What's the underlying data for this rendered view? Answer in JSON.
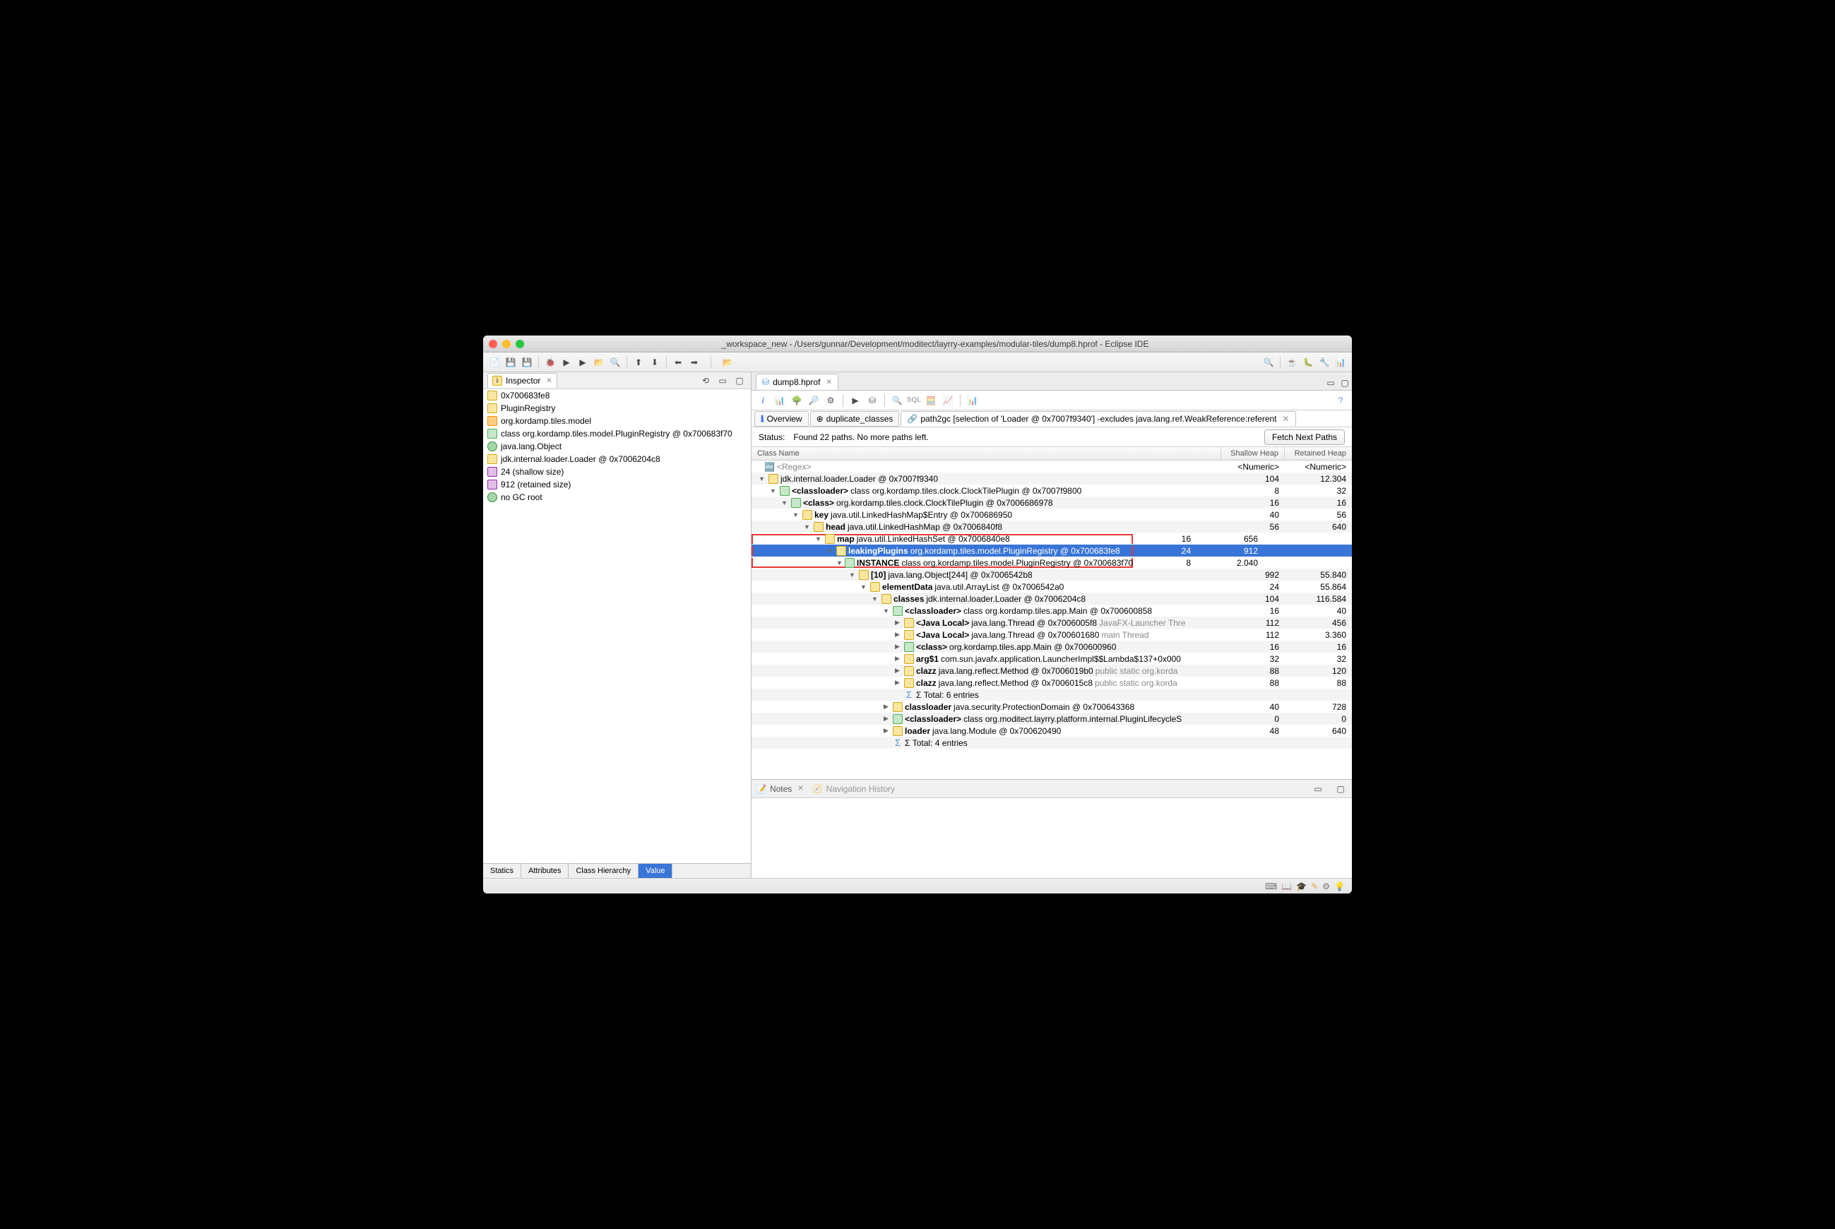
{
  "window": {
    "title": "_workspace_new - /Users/gunnar/Development/moditect/layrry-examples/modular-tiles/dump8.hprof - Eclipse IDE"
  },
  "inspector": {
    "tab_label": "Inspector",
    "rows": [
      {
        "icon": "obj",
        "text": "0x700683fe8"
      },
      {
        "icon": "obj",
        "text": "PluginRegistry"
      },
      {
        "icon": "pkg",
        "text": "org.kordamp.tiles.model"
      },
      {
        "icon": "class",
        "text": "class org.kordamp.tiles.model.PluginRegistry @ 0x700683f70"
      },
      {
        "icon": "gc",
        "text": "java.lang.Object"
      },
      {
        "icon": "obj",
        "text": "jdk.internal.loader.Loader @ 0x7006204c8"
      },
      {
        "icon": "size",
        "text": "24 (shallow size)"
      },
      {
        "icon": "size",
        "text": "912 (retained size)"
      },
      {
        "icon": "gc",
        "text": "no GC root"
      }
    ],
    "sub_tabs": [
      "Statics",
      "Attributes",
      "Class Hierarchy",
      "Value"
    ],
    "active_sub_tab": 3
  },
  "editor": {
    "tab_label": "dump8.hprof",
    "inner_tabs": [
      {
        "icon": "i",
        "label": "Overview",
        "closable": false
      },
      {
        "icon": "dup",
        "label": "duplicate_classes",
        "closable": false
      },
      {
        "icon": "path",
        "label": "path2gc  [selection of 'Loader @ 0x7007f9340'] -excludes java.lang.ref.WeakReference:referent",
        "closable": true,
        "active": true
      }
    ],
    "status_label": "Status:",
    "status_text": "Found 22 paths. No more paths left.",
    "fetch_label": "Fetch Next Paths",
    "columns": {
      "name": "Class Name",
      "shallow": "Shallow Heap",
      "retained": "Retained Heap",
      "regex": "<Regex>",
      "numeric": "<Numeric>"
    },
    "rows": [
      {
        "depth": 0,
        "open": true,
        "icon": "obj",
        "bold": "",
        "text": "jdk.internal.loader.Loader @ 0x7007f9340",
        "shallow": "104",
        "retained": "12.304"
      },
      {
        "depth": 1,
        "open": true,
        "icon": "class",
        "bold": "<classloader>",
        "text": "class org.kordamp.tiles.clock.ClockTilePlugin @ 0x7007f9800",
        "shallow": "8",
        "retained": "32"
      },
      {
        "depth": 2,
        "open": true,
        "icon": "class",
        "bold": "<class>",
        "text": "org.kordamp.tiles.clock.ClockTilePlugin @ 0x7006686978",
        "shallow": "16",
        "retained": "16"
      },
      {
        "depth": 3,
        "open": true,
        "icon": "obj",
        "bold": "key",
        "text": "java.util.LinkedHashMap$Entry @ 0x700686950",
        "shallow": "40",
        "retained": "56"
      },
      {
        "depth": 4,
        "open": true,
        "icon": "obj",
        "bold": "head",
        "text": "java.util.LinkedHashMap @ 0x7006840f8",
        "shallow": "56",
        "retained": "640"
      },
      {
        "depth": 5,
        "open": true,
        "icon": "obj",
        "bold": "map",
        "text": "java.util.LinkedHashSet @ 0x7006840e8",
        "shallow": "16",
        "retained": "656",
        "hl": "top"
      },
      {
        "depth": 6,
        "open": true,
        "icon": "obj",
        "bold": "leakingPlugins",
        "text": "org.kordamp.tiles.model.PluginRegistry @ 0x700683fe8",
        "shallow": "24",
        "retained": "912",
        "selected": true,
        "hl": "mid"
      },
      {
        "depth": 7,
        "open": true,
        "icon": "class",
        "bold": "INSTANCE",
        "text": "class org.kordamp.tiles.model.PluginRegistry @ 0x700683f70",
        "shallow": "8",
        "retained": "2.040",
        "hl": "bot"
      },
      {
        "depth": 8,
        "open": true,
        "icon": "obj",
        "bold": "[10]",
        "text": "java.lang.Object[244] @ 0x7006542b8",
        "shallow": "992",
        "retained": "55.840"
      },
      {
        "depth": 9,
        "open": true,
        "icon": "obj",
        "bold": "elementData",
        "text": "java.util.ArrayList @ 0x7006542a0",
        "shallow": "24",
        "retained": "55.864"
      },
      {
        "depth": 10,
        "open": true,
        "icon": "obj",
        "bold": "classes",
        "text": "jdk.internal.loader.Loader @ 0x7006204c8",
        "shallow": "104",
        "retained": "116.584"
      },
      {
        "depth": 11,
        "open": true,
        "icon": "class",
        "bold": "<classloader>",
        "text": "class org.kordamp.tiles.app.Main @ 0x700600858",
        "shallow": "16",
        "retained": "40"
      },
      {
        "depth": 12,
        "open": false,
        "icon": "obj",
        "bold": "<Java Local>",
        "text": "java.lang.Thread @ 0x7006005f8",
        "trail": "JavaFX-Launcher  Thre",
        "shallow": "112",
        "retained": "456"
      },
      {
        "depth": 12,
        "open": false,
        "icon": "obj",
        "bold": "<Java Local>",
        "text": "java.lang.Thread @ 0x700601680",
        "trail": "main  Thread",
        "shallow": "112",
        "retained": "3.360"
      },
      {
        "depth": 12,
        "open": false,
        "icon": "class",
        "bold": "<class>",
        "text": "org.kordamp.tiles.app.Main @ 0x700600960",
        "shallow": "16",
        "retained": "16"
      },
      {
        "depth": 12,
        "open": false,
        "icon": "obj",
        "bold": "arg$1",
        "text": "com.sun.javafx.application.LauncherImpl$$Lambda$137+0x000",
        "shallow": "32",
        "retained": "32"
      },
      {
        "depth": 12,
        "open": false,
        "icon": "obj",
        "bold": "clazz",
        "text": "java.lang.reflect.Method @ 0x7006019b0",
        "trail": "public static  org.korda",
        "shallow": "88",
        "retained": "120"
      },
      {
        "depth": 12,
        "open": false,
        "icon": "obj",
        "bold": "clazz",
        "text": "java.lang.reflect.Method @ 0x7006015c8",
        "trail": "public static  org.korda",
        "shallow": "88",
        "retained": "88"
      },
      {
        "depth": 12,
        "open": null,
        "icon": "sum",
        "bold": "",
        "text": "Σ Total: 6 entries",
        "shallow": "",
        "retained": ""
      },
      {
        "depth": 11,
        "open": false,
        "icon": "obj",
        "bold": "classloader",
        "text": "java.security.ProtectionDomain @ 0x700643368",
        "shallow": "40",
        "retained": "728"
      },
      {
        "depth": 11,
        "open": false,
        "icon": "class",
        "bold": "<classloader>",
        "text": "class org.moditect.layrry.platform.internal.PluginLifecycleS",
        "shallow": "0",
        "retained": "0"
      },
      {
        "depth": 11,
        "open": false,
        "icon": "obj",
        "bold": "loader",
        "text": "java.lang.Module @ 0x700620490",
        "shallow": "48",
        "retained": "640"
      },
      {
        "depth": 11,
        "open": null,
        "icon": "sum",
        "bold": "",
        "text": "Σ Total: 4 entries",
        "shallow": "",
        "retained": ""
      }
    ]
  },
  "bottom": {
    "notes": "Notes",
    "nav": "Navigation History"
  }
}
